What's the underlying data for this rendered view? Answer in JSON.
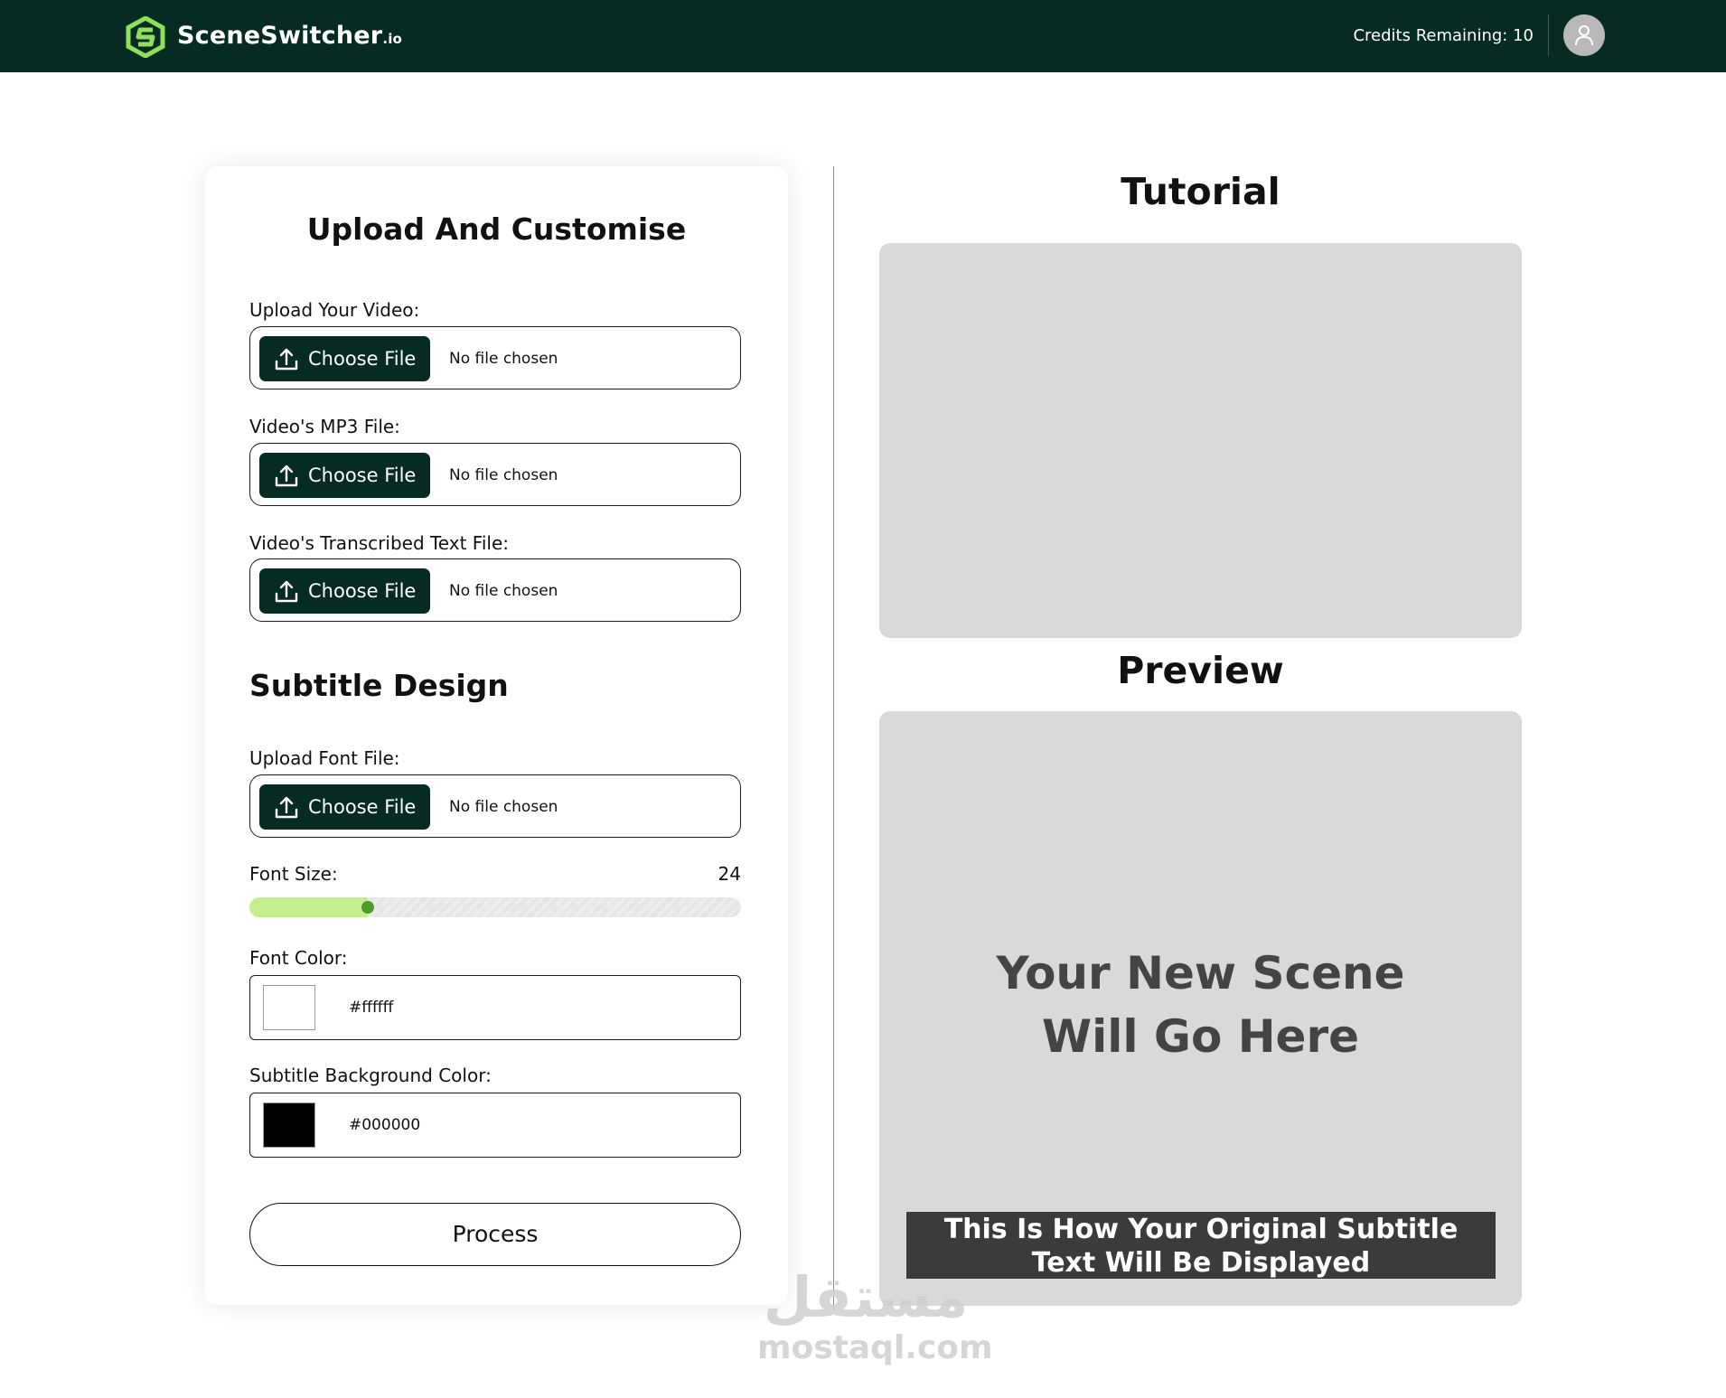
{
  "header": {
    "brand_name": "SceneSwitcher",
    "brand_suffix": ".io",
    "credits_text": "Credits Remaining: 10",
    "bg_color": "#062b22",
    "accent_color": "#8fe05a",
    "logo_icon": "hexagon-s-logo-icon",
    "avatar_icon": "user-icon"
  },
  "upload": {
    "title": "Upload And Customise",
    "fields": [
      {
        "label": "Upload Your Video:",
        "button": "Choose File",
        "status": "No file chosen"
      },
      {
        "label": "Video's MP3 File:",
        "button": "Choose File",
        "status": "No file chosen"
      },
      {
        "label": "Video's Transcribed Text File:",
        "button": "Choose File",
        "status": "No file chosen"
      }
    ]
  },
  "design": {
    "title": "Subtitle Design",
    "font_file": {
      "label": "Upload Font File:",
      "button": "Choose File",
      "status": "No file chosen"
    },
    "font_size": {
      "label": "Font Size:",
      "value": "24",
      "slider_fraction": 0.24
    },
    "font_color": {
      "label": "Font Color:",
      "hex": "#ffffff"
    },
    "bg_color": {
      "label": "Subtitle Background Color:",
      "hex": "#000000"
    },
    "process_label": "Process"
  },
  "tutorial": {
    "title": "Tutorial"
  },
  "preview": {
    "title": "Preview",
    "placeholder": "Your New Scene Will Go Here",
    "subtitle_sample": "This Is How Your Original Subtitle Text Will Be Displayed"
  },
  "watermark": {
    "arabic": "مستقل",
    "latin": "mostaql.com"
  }
}
